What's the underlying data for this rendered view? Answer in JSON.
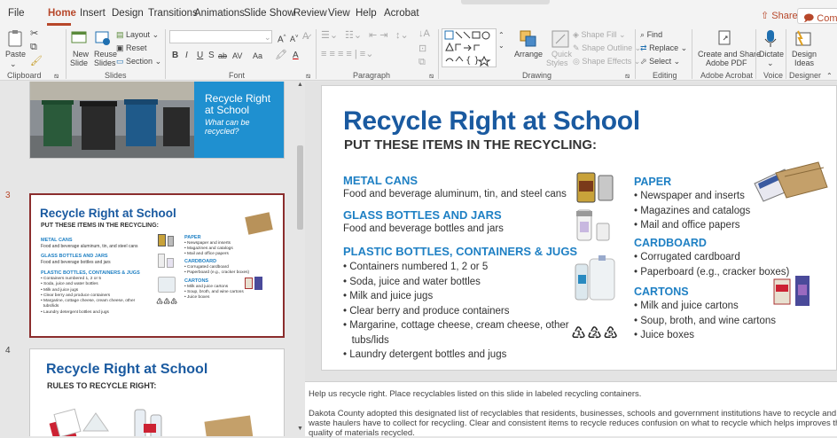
{
  "menu": {
    "tabs": [
      "File",
      "Home",
      "Insert",
      "Design",
      "Transitions",
      "Animations",
      "Slide Show",
      "Review",
      "View",
      "Help",
      "Acrobat"
    ],
    "share": "Share",
    "comments": "Comm"
  },
  "ribbon": {
    "clipboard": {
      "paste": "Paste",
      "label": "Clipboard"
    },
    "slides": {
      "new_slide": "New",
      "new_slide2": "Slide",
      "reuse": "Reuse",
      "reuse2": "Slides",
      "layout": "Layout",
      "reset": "Reset",
      "section": "Section",
      "label": "Slides"
    },
    "font": {
      "label": "Font",
      "bold": "B",
      "italic": "I",
      "underline": "U",
      "strike": "S",
      "abc": "ab",
      "av": "AV",
      "aa": "Aa",
      "grow": "A",
      "shrink": "A"
    },
    "paragraph": {
      "label": "Paragraph"
    },
    "drawing": {
      "arrange": "Arrange",
      "quick": "Quick",
      "styles": "Styles",
      "shape_fill": "Shape Fill",
      "shape_outline": "Shape Outline",
      "shape_effects": "Shape Effects",
      "label": "Drawing"
    },
    "editing": {
      "find": "Find",
      "replace": "Replace",
      "select": "Select",
      "label": "Editing"
    },
    "acrobat": {
      "create1": "Create and Share",
      "create2": "Adobe PDF",
      "label": "Adobe Acrobat"
    },
    "voice": {
      "dictate": "Dictate",
      "label": "Voice"
    },
    "designer": {
      "design1": "Design",
      "design2": "Ideas",
      "label": "Designer"
    }
  },
  "thumbnails": {
    "slide2": {
      "title1": "Recycle Right",
      "title2": "at School",
      "sub1": "What can be",
      "sub2": "recycled?"
    },
    "slide3": {
      "num": "3",
      "title": "Recycle Right at School",
      "subtitle": "PUT THESE ITEMS IN THE RECYCLING:",
      "metal_h": "METAL CANS",
      "metal_t": "Food and beverage aluminum, tin, and steel cans",
      "glass_h": "GLASS BOTTLES AND JARS",
      "glass_t": "Food and beverage bottles and jars",
      "plastic_h": "PLASTIC BOTTLES, CONTAINERS & JUGS",
      "plastic_items": [
        "Containers numbered 1, 2 or 5",
        "Soda, juice and water bottles",
        "Milk and juice jugs",
        "Clear berry and produce containers",
        "Margarine, cottage cheese, cream cheese, other",
        "tubs/lids",
        "Laundry detergent bottles and jugs"
      ],
      "paper_h": "PAPER",
      "paper_items": [
        "Newspaper and inserts",
        "Magazines and catalogs",
        "Mail and office papers"
      ],
      "cardboard_h": "CARDBOARD",
      "cardboard_items": [
        "Corrugated cardboard",
        "Paperboard (e.g., cracker boxes)"
      ],
      "cartons_h": "CARTONS",
      "cartons_items": [
        "Milk and juice cartons",
        "Soup, broth, and wine cartons",
        "Juice boxes"
      ]
    },
    "slide4": {
      "num": "4",
      "title": "Recycle Right at School",
      "subtitle": "RULES TO RECYCLE RIGHT:"
    }
  },
  "slide": {
    "title": "Recycle Right at School",
    "subtitle": "PUT THESE ITEMS IN THE RECYCLING:",
    "metal_h": "METAL CANS",
    "metal_t": "Food and beverage aluminum, tin, and steel cans",
    "glass_h": "GLASS BOTTLES AND JARS",
    "glass_t": "Food and beverage bottles and jars",
    "plastic_h": "PLASTIC BOTTLES, CONTAINERS & JUGS",
    "plastic_items": [
      "Containers numbered 1, 2 or 5",
      "Soda, juice and water bottles",
      "Milk and juice jugs",
      "Clear berry and produce containers",
      "Margarine, cottage cheese, cream cheese, other",
      "tubs/lids",
      "Laundry detergent bottles and jugs"
    ],
    "paper_h": "PAPER",
    "paper_items": [
      "Newspaper and inserts",
      "Magazines and catalogs",
      "Mail and office papers"
    ],
    "cardboard_h": "CARDBOARD",
    "cardboard_items": [
      "Corrugated cardboard",
      "Paperboard (e.g., cracker boxes)"
    ],
    "cartons_h": "CARTONS",
    "cartons_items": [
      "Milk and juice cartons",
      "Soup, broth, and wine cartons",
      "Juice boxes"
    ],
    "recycle_symbols": "♳♴♷"
  },
  "notes": {
    "line1": "Help us recycle right.  Place recyclables listed on this slide in labeled recycling containers.",
    "line2": "Dakota County adopted this designated list of recyclables that residents, businesses, schools and government institutions have to recycle and",
    "line3": "waste haulers have to collect for recycling. Clear and consistent items to recycle reduces confusion on what to recycle which helps improves the",
    "line4": "quality of materials recycled."
  },
  "colors": {
    "accent": "#b7472a",
    "slide_title": "#1a5aa0",
    "heading": "#1f80c4",
    "selected_border": "#8b2d2d"
  }
}
